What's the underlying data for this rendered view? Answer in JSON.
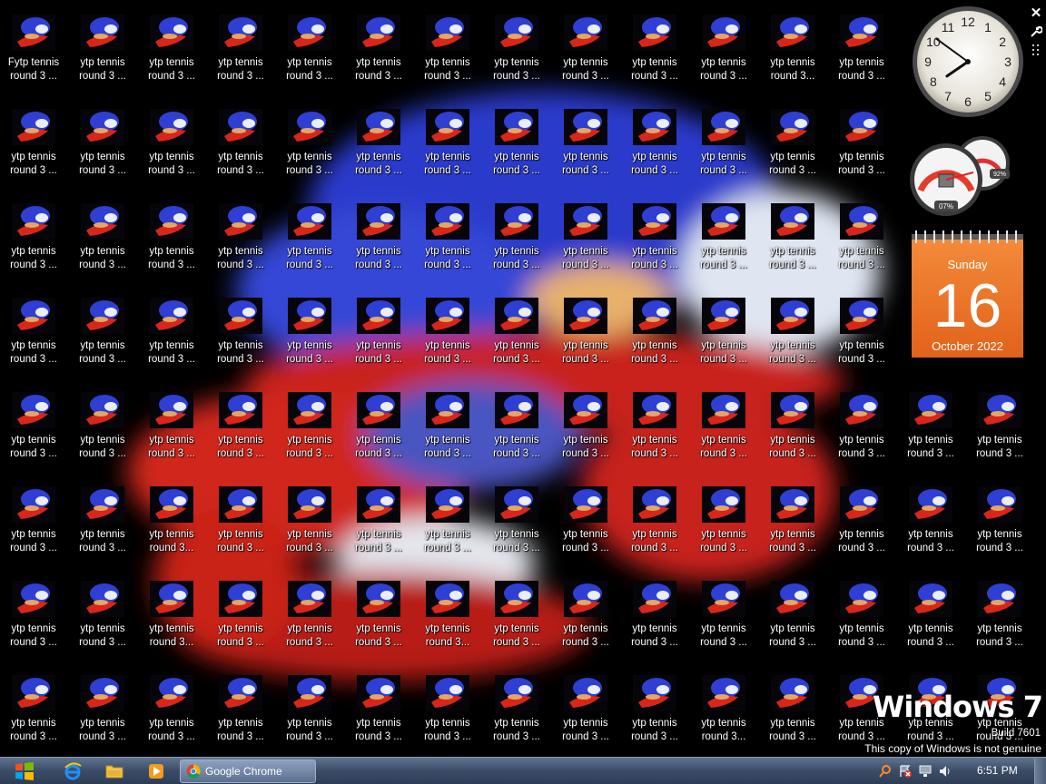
{
  "desktop": {
    "icon_label": "ytp tennis\nround 3 ...",
    "icon_label_alt": "ytp tennis\nround 3...",
    "first_icon_label": "Fytp tennis\nround 3 ...",
    "rows": 8,
    "cols": 15
  },
  "gadgets": {
    "controls": {
      "close": "✕",
      "options": "🔧",
      "drag": "⁞⁞"
    },
    "clock": {
      "hour": 7,
      "minute": 51,
      "numerals": [
        "12",
        "1",
        "2",
        "3",
        "4",
        "5",
        "6",
        "7",
        "8",
        "9",
        "10",
        "11"
      ]
    },
    "cpu_meter": {
      "cpu_percent": "07%",
      "memory_percent": "92%"
    },
    "calendar": {
      "weekday": "Sunday",
      "day": "16",
      "month_year": "October 2022"
    }
  },
  "watermark": {
    "brand": "Windows 7",
    "build": "Build 7601",
    "genuine": "This copy of Windows is not genuine"
  },
  "taskbar": {
    "start_icon": "windows-logo-icon",
    "pinned": [
      "internet-explorer-icon",
      "folder-icon",
      "media-player-icon"
    ],
    "active_window": "Google Chrome",
    "time": "6:51 PM"
  },
  "colors": {
    "taskbar": "#3b4c66",
    "calendar": "#e8701f",
    "wallpaper_blue": "#2d3fd0",
    "wallpaper_red": "#d8261a"
  }
}
